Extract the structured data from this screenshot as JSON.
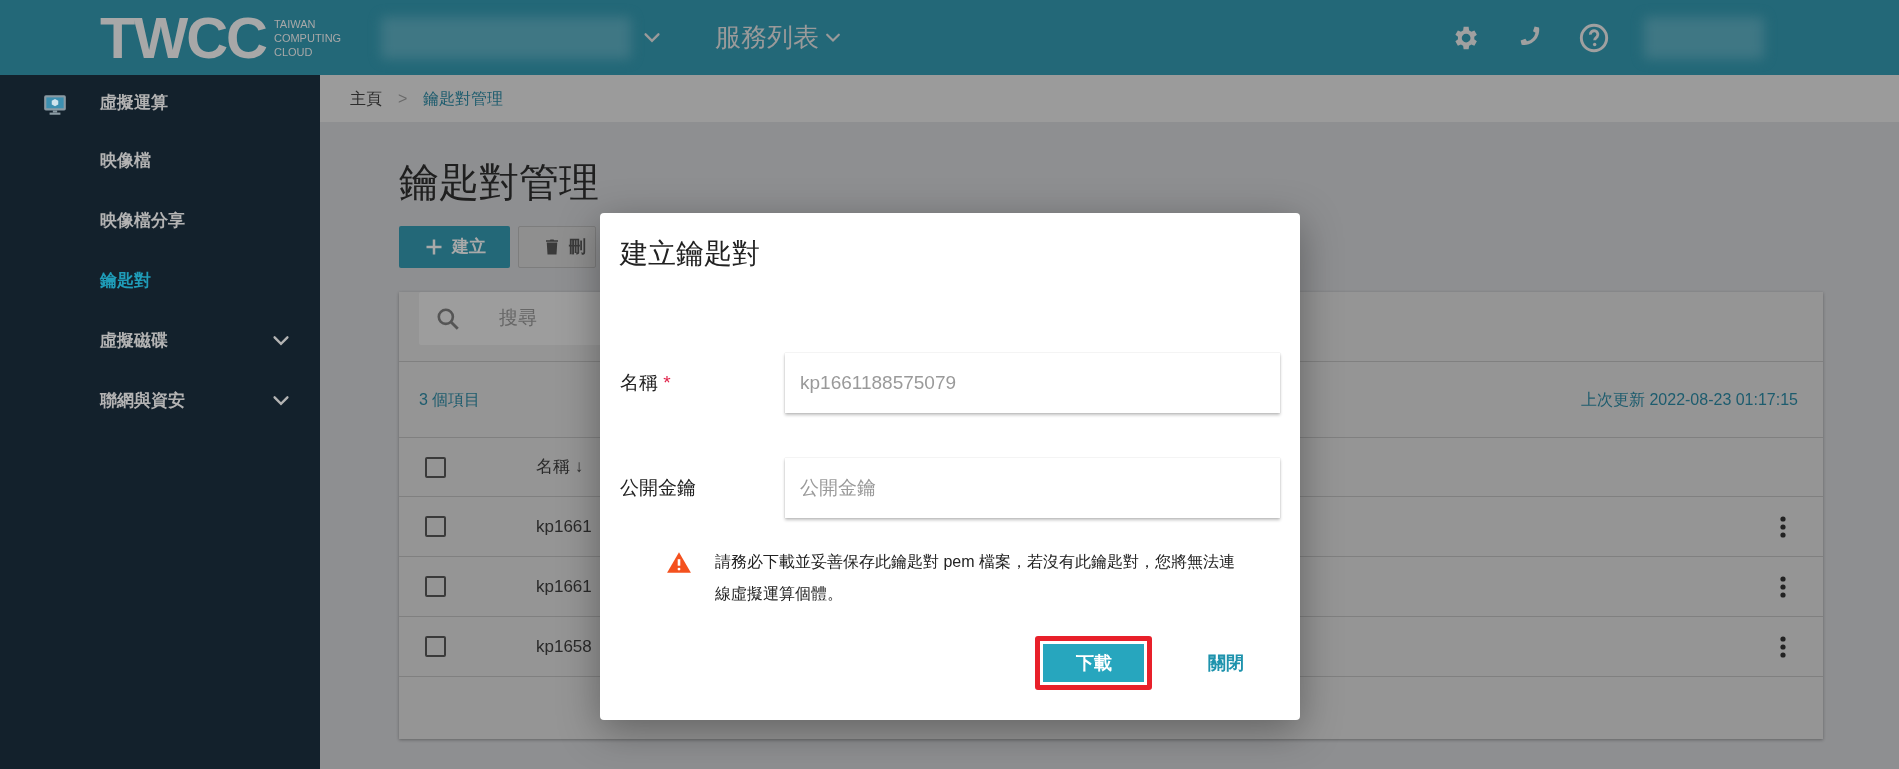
{
  "header": {
    "logo": {
      "letters": "TWCC",
      "subtitle_lines": [
        "TAIWAN",
        "COMPUTING",
        "CLOUD"
      ]
    },
    "menu": "服務列表"
  },
  "sidebar": {
    "items": [
      {
        "label": "虛擬運算",
        "kind": "heading",
        "selected": false
      },
      {
        "label": "映像檔",
        "kind": "link",
        "selected": false
      },
      {
        "label": "映像檔分享",
        "kind": "link",
        "selected": false
      },
      {
        "label": "鑰匙對",
        "kind": "link",
        "selected": true
      },
      {
        "label": "虛擬磁碟",
        "kind": "group",
        "selected": false,
        "expanded": false
      },
      {
        "label": "聯網與資安",
        "kind": "group",
        "selected": false,
        "expanded": false
      }
    ]
  },
  "breadcrumb": {
    "separator": ">",
    "items": [
      {
        "label": "主頁",
        "selected": false
      },
      {
        "label": "鑰匙對管理",
        "selected": true
      }
    ]
  },
  "page": {
    "title": "鑰匙對管理",
    "toolbar": [
      {
        "label": "建立",
        "kind": "primary"
      },
      {
        "label": "刪",
        "kind": "outline"
      }
    ],
    "search": {
      "placeholder": "搜尋"
    },
    "count": "3 個項目",
    "updated": "上次更新 2022-08-23 01:17:15",
    "table": {
      "header_checked": false,
      "columns": [
        {
          "label": "名稱",
          "sort_mark": "↓"
        }
      ],
      "rows": [
        {
          "name": "kp1661",
          "checked": false
        },
        {
          "name": "kp1661",
          "checked": false
        },
        {
          "name": "kp1658",
          "checked": false
        }
      ]
    }
  },
  "dialog": {
    "title": "建立鑰匙對",
    "fields": [
      {
        "label": "名稱",
        "required_mark": "*",
        "placeholder": "kp1661188575079"
      },
      {
        "label": "公開金鑰",
        "placeholder": "公開金鑰"
      }
    ],
    "warning": "請務必下載並妥善保存此鑰匙對 pem 檔案，若沒有此鑰匙對，您將無法連線虛擬運算個體。",
    "buttons": [
      {
        "label": "下載",
        "kind": "primary",
        "highlighted": true
      },
      {
        "label": "關閉",
        "kind": "link"
      }
    ]
  }
}
